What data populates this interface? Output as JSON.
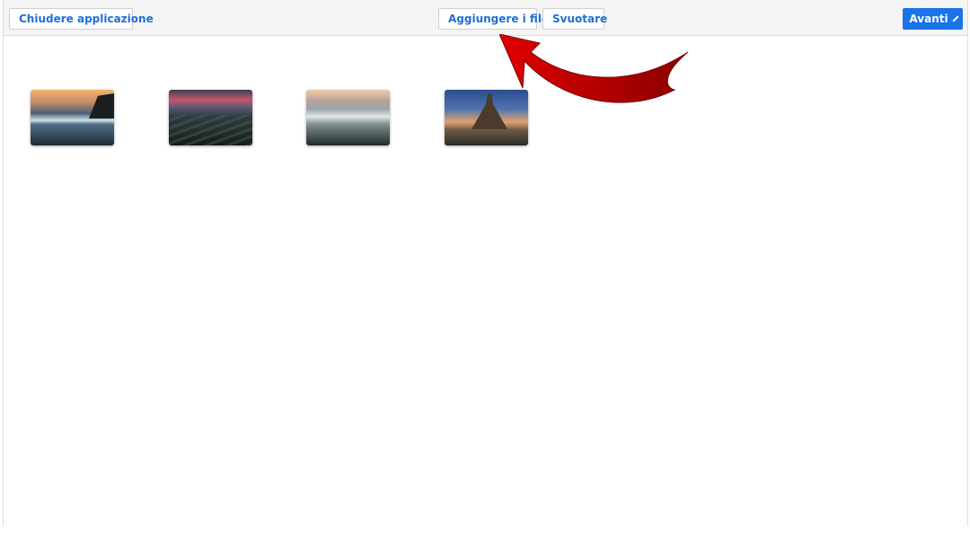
{
  "toolbar": {
    "close_label": "Chiudere applicazione",
    "add_files_label": "Aggiungere i file",
    "empty_label": "Svuotare",
    "next_label": "Avanti"
  },
  "colors": {
    "accent": "#1a73e8",
    "arrow": "#c00000"
  },
  "icons": {
    "next": "chevron-right-icon"
  },
  "thumbnails": [
    {
      "name": "thumbnail-beach-sunset"
    },
    {
      "name": "thumbnail-rock-ribs"
    },
    {
      "name": "thumbnail-misty-mountains"
    },
    {
      "name": "thumbnail-desert-peak"
    }
  ]
}
